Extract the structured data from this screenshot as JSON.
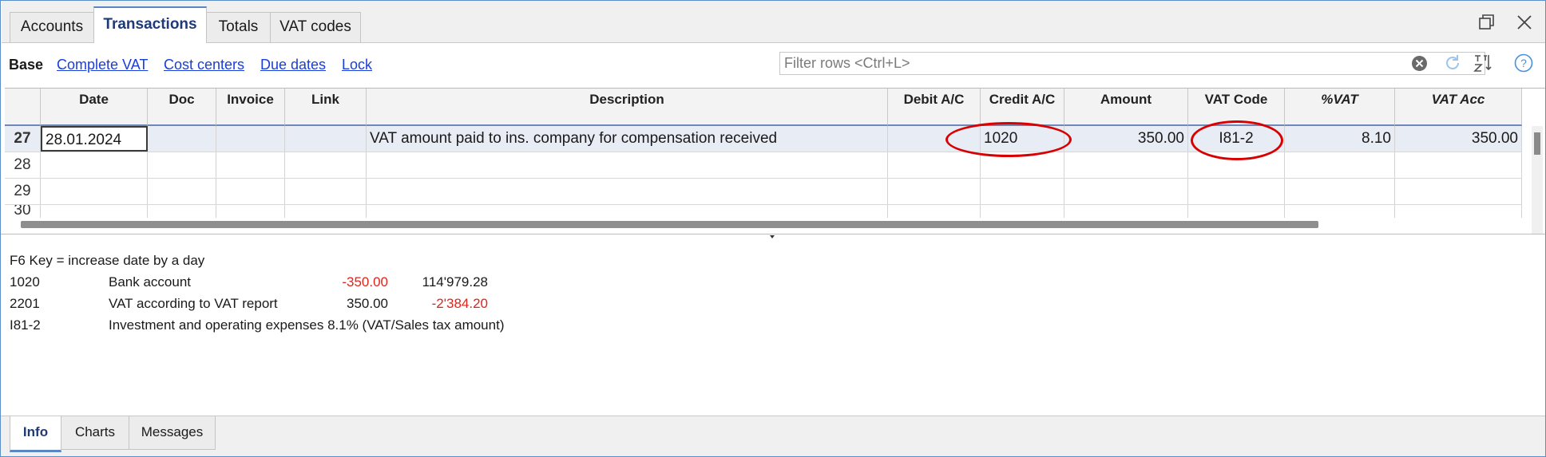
{
  "top_tabs": [
    "Accounts",
    "Transactions",
    "Totals",
    "VAT codes"
  ],
  "active_top_tab": "Transactions",
  "views": {
    "base": "Base",
    "links": [
      "Complete VAT",
      "Cost centers",
      "Due dates",
      "Lock"
    ]
  },
  "filter": {
    "placeholder": "Filter rows <Ctrl+L>"
  },
  "columns": [
    "Date",
    "Doc",
    "Invoice",
    "Link",
    "Description",
    "Debit A/C",
    "Credit A/C",
    "Amount",
    "VAT Code",
    "%VAT",
    "VAT Acc"
  ],
  "rows": [
    {
      "num": "27",
      "date": "28.01.2024",
      "doc": "",
      "invoice": "",
      "link": "",
      "description": "VAT amount paid to ins. company for compensation received",
      "debit": "",
      "credit": "1020",
      "amount": "350.00",
      "vat_code": "I81-2",
      "vat_pct": "8.10",
      "vat_acc": "350.00"
    },
    {
      "num": "28",
      "date": "",
      "doc": "",
      "invoice": "",
      "link": "",
      "description": "",
      "debit": "",
      "credit": "",
      "amount": "",
      "vat_code": "",
      "vat_pct": "",
      "vat_acc": ""
    },
    {
      "num": "29",
      "date": "",
      "doc": "",
      "invoice": "",
      "link": "",
      "description": "",
      "debit": "",
      "credit": "",
      "amount": "",
      "vat_code": "",
      "vat_pct": "",
      "vat_acc": ""
    },
    {
      "num": "30",
      "date": "",
      "doc": "",
      "invoice": "",
      "link": "",
      "description": "",
      "debit": "",
      "credit": "",
      "amount": "",
      "vat_code": "",
      "vat_pct": "",
      "vat_acc": ""
    }
  ],
  "info": {
    "hint": "F6 Key = increase date by a day",
    "lines": [
      {
        "code": "1020",
        "label": "Bank account",
        "amount": "-350.00",
        "balance": "114'979.28"
      },
      {
        "code": "2201",
        "label": "VAT according to VAT report",
        "amount": "350.00",
        "balance": "-2'384.20"
      },
      {
        "code": "I81-2",
        "label": "Investment and operating expenses 8.1% (VAT/Sales tax amount)",
        "amount": "",
        "balance": ""
      }
    ]
  },
  "bottom_tabs": [
    "Info",
    "Charts",
    "Messages"
  ],
  "active_bottom_tab": "Info",
  "colors": {
    "accent": "#5a86c6",
    "negative": "#e0241b",
    "link": "#1a3ed8",
    "annotation": "#d80000"
  },
  "icons": [
    "restore-window-icon",
    "close-window-icon",
    "clear-filter-icon",
    "refresh-icon",
    "sort-icon",
    "help-icon"
  ]
}
